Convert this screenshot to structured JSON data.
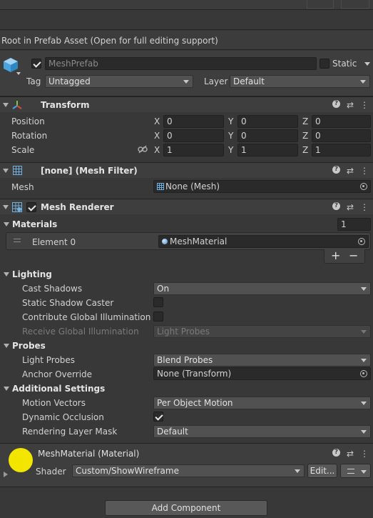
{
  "top_notice": "Root in Prefab Asset (Open for full editing support)",
  "gameobject": {
    "name": "MeshPrefab",
    "static_label": "Static",
    "tag_label": "Tag",
    "tag_value": "Untagged",
    "layer_label": "Layer",
    "layer_value": "Default",
    "active": true
  },
  "transform": {
    "title": "Transform",
    "axis": {
      "x": "X",
      "y": "Y",
      "z": "Z"
    },
    "position": {
      "label": "Position",
      "x": "0",
      "y": "0",
      "z": "0"
    },
    "rotation": {
      "label": "Rotation",
      "x": "0",
      "y": "0",
      "z": "0"
    },
    "scale": {
      "label": "Scale",
      "x": "1",
      "y": "1",
      "z": "1"
    }
  },
  "mesh_filter": {
    "title": "[none] (Mesh Filter)",
    "mesh_label": "Mesh",
    "mesh_value": "None (Mesh)"
  },
  "mesh_renderer": {
    "title": "Mesh Renderer",
    "materials_label": "Materials",
    "materials_count": "1",
    "element0_label": "Element 0",
    "element0_value": "MeshMaterial",
    "add_symbol": "+",
    "remove_symbol": "−",
    "lighting_label": "Lighting",
    "cast_shadows_label": "Cast Shadows",
    "cast_shadows_value": "On",
    "static_shadow_label": "Static Shadow Caster",
    "contribute_gi_label": "Contribute Global Illumination",
    "receive_gi_label": "Receive Global Illumination",
    "receive_gi_value": "Light Probes",
    "probes_label": "Probes",
    "light_probes_label": "Light Probes",
    "light_probes_value": "Blend Probes",
    "anchor_override_label": "Anchor Override",
    "anchor_override_value": "None (Transform)",
    "additional_label": "Additional Settings",
    "motion_vectors_label": "Motion Vectors",
    "motion_vectors_value": "Per Object Motion",
    "dynamic_occlusion_label": "Dynamic Occlusion",
    "dynamic_occlusion_checked": true,
    "rendering_layer_label": "Rendering Layer Mask",
    "rendering_layer_value": "Default"
  },
  "material": {
    "title": "MeshMaterial (Material)",
    "shader_label": "Shader",
    "shader_value": "Custom/ShowWireframe",
    "edit_label": "Edit...",
    "swatch_color": "#f2e600"
  },
  "add_component_label": "Add Component",
  "colors": {
    "background": "#383838",
    "header": "#3e3e3e",
    "field": "#2a2a2a",
    "dropdown": "#515151",
    "transform_icon": "#e8a020",
    "mesh_icon": "#6fb0e0"
  }
}
